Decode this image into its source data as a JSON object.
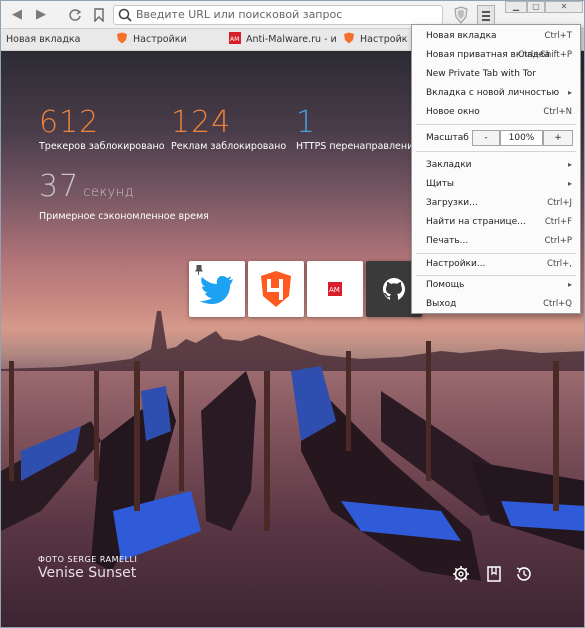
{
  "toolbar": {
    "back": "◀",
    "forward": "▶",
    "reload": "C",
    "bookmark": "⚑",
    "url_placeholder": "Введите URL или поисковой запрос"
  },
  "tabs": [
    {
      "label": "Новая вкладка"
    },
    {
      "label": "Настройки"
    },
    {
      "label": "Anti-Malware.ru - инф"
    },
    {
      "label": "Настройки"
    }
  ],
  "stats": [
    {
      "value": "612",
      "label": "Трекеров заблокировано",
      "color": "#f0833a"
    },
    {
      "value": "124",
      "label": "Реклам заблокировано",
      "color": "#f0833a"
    },
    {
      "value": "1",
      "label": "HTTPS перенаправление",
      "color": "#4aa3e0"
    }
  ],
  "time_saved": {
    "value": "37",
    "unit": "секунд",
    "label": "Примерное сэкономленное время"
  },
  "photo": {
    "credit": "ФОТО SERGE RAMELLI",
    "title": "Venise Sunset"
  },
  "tiles": [
    {
      "name": "twitter",
      "color": "#1da1f2"
    },
    {
      "name": "4pda",
      "color": "#ff5a1f"
    },
    {
      "name": "anti-malware",
      "color": "#d8202a"
    },
    {
      "name": "github",
      "color": "#ffffff"
    }
  ],
  "menu": {
    "items": [
      {
        "label": "Новая вкладка",
        "shortcut": "Ctrl+T"
      },
      {
        "label": "Новая приватная вкладка",
        "shortcut": "Ctrl+Shift+P"
      },
      {
        "label": "New Private Tab with Tor",
        "shortcut": ""
      },
      {
        "label": "Вкладка с новой личностью",
        "shortcut": "▸"
      },
      {
        "label": "Новое окно",
        "shortcut": "Ctrl+N"
      }
    ],
    "zoom": {
      "label": "Масштаб",
      "minus": "-",
      "value": "100%",
      "plus": "+"
    },
    "items2": [
      {
        "label": "Закладки",
        "shortcut": "▸"
      },
      {
        "label": "Щиты",
        "shortcut": "▸"
      },
      {
        "label": "Загрузки...",
        "shortcut": "Ctrl+J"
      },
      {
        "label": "Найти на странице...",
        "shortcut": "Ctrl+F"
      },
      {
        "label": "Печать...",
        "shortcut": "Ctrl+P"
      }
    ],
    "items3": [
      {
        "label": "Настройки...",
        "shortcut": "Ctrl+,"
      }
    ],
    "items4": [
      {
        "label": "Помощь",
        "shortcut": "▸"
      },
      {
        "label": "Выход",
        "shortcut": "Ctrl+Q"
      }
    ]
  }
}
